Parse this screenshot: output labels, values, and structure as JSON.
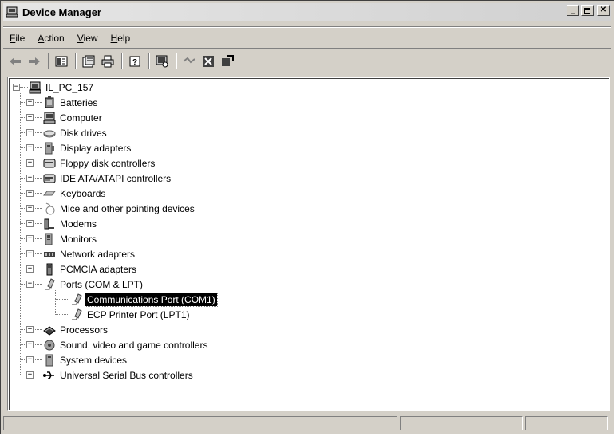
{
  "window": {
    "title": "Device Manager"
  },
  "menubar": {
    "items": [
      {
        "label": "File",
        "key": "F",
        "rest": "ile"
      },
      {
        "label": "Action",
        "key": "A",
        "rest": "ction"
      },
      {
        "label": "View",
        "key": "V",
        "rest": "iew"
      },
      {
        "label": "Help",
        "key": "H",
        "rest": "elp"
      }
    ]
  },
  "toolbar": {
    "buttons": [
      "back-icon",
      "forward-icon",
      "show-hide-tree-icon",
      "properties-icon",
      "print-icon",
      "help-icon",
      "scan-hardware-icon",
      "uninstall-icon",
      "disable-icon",
      "update-driver-icon"
    ]
  },
  "tree": {
    "root": "IL_PC_157",
    "categories": [
      {
        "label": "Batteries",
        "icon": "battery-icon",
        "expanded": false
      },
      {
        "label": "Computer",
        "icon": "computer-icon",
        "expanded": false
      },
      {
        "label": "Disk drives",
        "icon": "disk-drive-icon",
        "expanded": false
      },
      {
        "label": "Display adapters",
        "icon": "display-adapter-icon",
        "expanded": false
      },
      {
        "label": "Floppy disk controllers",
        "icon": "floppy-controller-icon",
        "expanded": false
      },
      {
        "label": "IDE ATA/ATAPI controllers",
        "icon": "ide-controller-icon",
        "expanded": false
      },
      {
        "label": "Keyboards",
        "icon": "keyboard-icon",
        "expanded": false
      },
      {
        "label": "Mice and other pointing devices",
        "icon": "mouse-icon",
        "expanded": false
      },
      {
        "label": "Modems",
        "icon": "modem-icon",
        "expanded": false
      },
      {
        "label": "Monitors",
        "icon": "monitor-icon",
        "expanded": false
      },
      {
        "label": "Network adapters",
        "icon": "network-adapter-icon",
        "expanded": false
      },
      {
        "label": "PCMCIA adapters",
        "icon": "pcmcia-icon",
        "expanded": false
      },
      {
        "label": "Ports (COM & LPT)",
        "icon": "port-icon",
        "expanded": true,
        "children": [
          {
            "label": "Communications Port (COM1)",
            "icon": "port-icon",
            "selected": true
          },
          {
            "label": "ECP Printer Port (LPT1)",
            "icon": "port-icon",
            "selected": false
          }
        ]
      },
      {
        "label": "Processors",
        "icon": "processor-icon",
        "expanded": false
      },
      {
        "label": "Sound, video and game controllers",
        "icon": "sound-icon",
        "expanded": false
      },
      {
        "label": "System devices",
        "icon": "system-device-icon",
        "expanded": false
      },
      {
        "label": "Universal Serial Bus controllers",
        "icon": "usb-icon",
        "expanded": false
      }
    ]
  },
  "statusbar": {
    "panels": [
      "",
      "",
      ""
    ]
  }
}
